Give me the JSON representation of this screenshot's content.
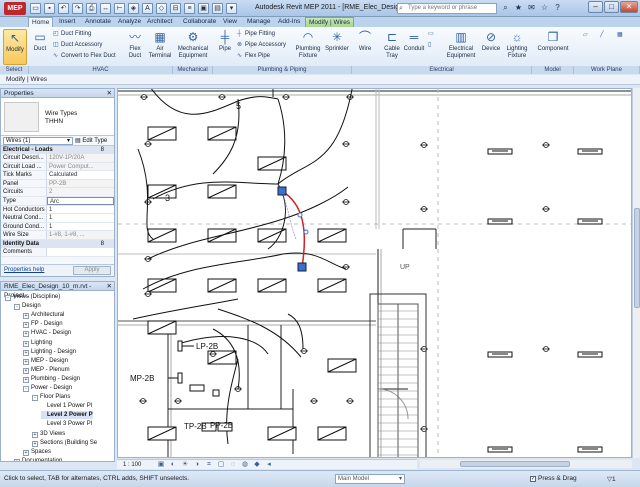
{
  "window": {
    "title": "Autodesk Revit MEP 2011 - [RME_Elec_Design_10_...",
    "logo": "MEP",
    "search_placeholder": "Type a keyword or phrase"
  },
  "tabs": [
    {
      "label": "Home",
      "state": "active"
    },
    {
      "label": "Insert",
      "state": ""
    },
    {
      "label": "Annotate",
      "state": ""
    },
    {
      "label": "Analyze",
      "state": ""
    },
    {
      "label": "Architect",
      "state": ""
    },
    {
      "label": "Collaborate",
      "state": ""
    },
    {
      "label": "View",
      "state": ""
    },
    {
      "label": "Manage",
      "state": ""
    },
    {
      "label": "Add-Ins",
      "state": ""
    },
    {
      "label": "Modify | Wires",
      "state": "context"
    }
  ],
  "ribbon": {
    "modify": "Modify",
    "duct": "Duct",
    "duct_fitting": "Duct Fitting",
    "duct_accessory": "Duct Accessory",
    "convert_flex": "Convert to Flex Duct",
    "flex_duct": [
      "Flex",
      "Duct"
    ],
    "air_terminal": [
      "Air",
      "Terminal"
    ],
    "mech_equipment": [
      "Mechanical",
      "Equipment"
    ],
    "pipe": "Pipe",
    "pipe_fitting": "Pipe Fitting",
    "pipe_accessory": "Pipe Accessory",
    "flex_pipe": "Flex Pipe",
    "plumbing_fixture": [
      "Plumbing",
      "Fixture"
    ],
    "sprinkler": "Sprinkler",
    "wire": "Wire",
    "cable_tray": [
      "Cable",
      "Tray"
    ],
    "conduit": "Conduit",
    "elec_equipment": [
      "Electrical",
      "Equipment"
    ],
    "device": "Device",
    "lighting_fixture": [
      "Lighting",
      "Fixture"
    ],
    "component": "Component",
    "panels": {
      "select": "Select",
      "hvac": "HVAC",
      "mechanical": "Mechanical",
      "plumbing": "Plumbing & Piping",
      "electrical": "Electrical",
      "model": "Model",
      "work_plane": "Work Plane"
    }
  },
  "context_bar": "Modify | Wires",
  "properties": {
    "title": "Properties",
    "type_line1": "Wire Types",
    "type_line2": "THHN",
    "filter": "Wires (1)",
    "edit_type": "Edit Type",
    "category": "Electrical - Loads",
    "category_count": "8",
    "rows": [
      {
        "k": "Circuit Descri...",
        "v": "120V-1P/20A",
        "grey": true
      },
      {
        "k": "Circuit Load ...",
        "v": "Power Comput...",
        "grey": true
      },
      {
        "k": "Tick Marks",
        "v": "Calculated",
        "grey": false
      },
      {
        "k": "Panel",
        "v": "PP-2B",
        "grey": true
      },
      {
        "k": "Circuits",
        "v": "2",
        "grey": true
      },
      {
        "k": "Type",
        "v": "Arc",
        "grey": false
      },
      {
        "k": "Hot Conductors",
        "v": "1",
        "grey": false
      },
      {
        "k": "Neutral Cond...",
        "v": "1",
        "grey": false
      },
      {
        "k": "Ground Cond...",
        "v": "1",
        "grey": false
      },
      {
        "k": "Wire Size",
        "v": "1-#8, 1-#8, ...",
        "grey": true
      }
    ],
    "identity": "Identity Data",
    "identity_count": "8",
    "comments": "Comments",
    "help": "Properties help",
    "apply": "Apply"
  },
  "browser": {
    "title": "RME_Elec_Design_10_m.rvt - Project...",
    "items": [
      {
        "label": "Views (Discipline)",
        "lvl": 0,
        "tw": "-",
        "bold": false,
        "sel": false
      },
      {
        "label": "Design",
        "lvl": 1,
        "tw": "-",
        "bold": false,
        "sel": false
      },
      {
        "label": "Architectural",
        "lvl": 2,
        "tw": "+",
        "bold": false,
        "sel": false
      },
      {
        "label": "FP - Design",
        "lvl": 2,
        "tw": "+",
        "bold": false,
        "sel": false
      },
      {
        "label": "HVAC - Design",
        "lvl": 2,
        "tw": "+",
        "bold": false,
        "sel": false
      },
      {
        "label": "Lighting",
        "lvl": 2,
        "tw": "+",
        "bold": false,
        "sel": false
      },
      {
        "label": "Lighting - Design",
        "lvl": 2,
        "tw": "+",
        "bold": false,
        "sel": false
      },
      {
        "label": "MEP - Design",
        "lvl": 2,
        "tw": "+",
        "bold": false,
        "sel": false
      },
      {
        "label": "MEP - Plenum",
        "lvl": 2,
        "tw": "+",
        "bold": false,
        "sel": false
      },
      {
        "label": "Plumbing - Design",
        "lvl": 2,
        "tw": "+",
        "bold": false,
        "sel": false
      },
      {
        "label": "Power - Design",
        "lvl": 2,
        "tw": "-",
        "bold": false,
        "sel": false
      },
      {
        "label": "Floor Plans",
        "lvl": 3,
        "tw": "-",
        "bold": false,
        "sel": false
      },
      {
        "label": "Level 1 Power Pl",
        "lvl": 4,
        "tw": "",
        "bold": false,
        "sel": false
      },
      {
        "label": "Level 2 Power P",
        "lvl": 4,
        "tw": "",
        "bold": true,
        "sel": true
      },
      {
        "label": "Level 3 Power Pl",
        "lvl": 4,
        "tw": "",
        "bold": false,
        "sel": false
      },
      {
        "label": "3D Views",
        "lvl": 3,
        "tw": "+",
        "bold": false,
        "sel": false
      },
      {
        "label": "Sections (Building Se",
        "lvl": 3,
        "tw": "+",
        "bold": false,
        "sel": false
      },
      {
        "label": "Spaces",
        "lvl": 2,
        "tw": "+",
        "bold": false,
        "sel": false
      },
      {
        "label": "Documentation",
        "lvl": 1,
        "tw": "+",
        "bold": false,
        "sel": false
      }
    ]
  },
  "drawing_labels": {
    "lp": "LP-2B",
    "mp": "MP-2B",
    "tp": "TP-2B",
    "pp": "PP-2B",
    "up": "UP",
    "num3": "3",
    "num5": "5"
  },
  "view_control": {
    "scale": "1 : 100"
  },
  "status": {
    "text": "Click to select, TAB for alternates, CTRL adds, SHIFT unselects.",
    "model": "Main Model",
    "press_drag": "Press & Drag",
    "filter_count": "1"
  }
}
